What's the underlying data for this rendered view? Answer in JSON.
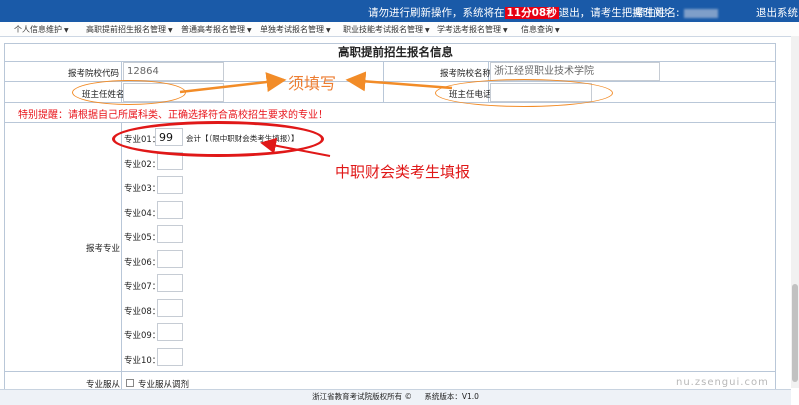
{
  "header": {
    "notice_prefix": "请勿进行刷新操作，系统将在",
    "countdown": "11分08秒",
    "notice_suffix": "退出，请考生把握时间!",
    "examinee_label": "考生姓名:",
    "logout": "退出系统",
    "bg_color": "#1a5aa8",
    "countdown_color": "#e60012"
  },
  "menu": [
    {
      "label": "个人信息维护"
    },
    {
      "label": "高职提前招生报名管理"
    },
    {
      "label": "普通高考报名管理"
    },
    {
      "label": "单独考试报名管理"
    },
    {
      "label": "职业技能考试报名管理"
    },
    {
      "label": "学考选考报名管理"
    },
    {
      "label": "信息查询"
    }
  ],
  "form": {
    "title": "高职提前招生报名信息",
    "school_code_label": "报考院校代码",
    "school_code_value": "12864",
    "school_name_label": "报考院校名称",
    "school_name_value": "浙江经贸职业技术学院",
    "teacher_name_label": "班主任姓名",
    "teacher_phone_label": "班主任电话",
    "warning": "特别提醒：请根据自己所属科类、正确选择符合高校招生要求的专业！",
    "major_section_label": "报考专业",
    "majors": [
      {
        "label": "专业01：",
        "value": "99",
        "desc": "会计【（限中职财会类考生填报）】"
      },
      {
        "label": "专业02：",
        "value": ""
      },
      {
        "label": "专业03：",
        "value": ""
      },
      {
        "label": "专业04：",
        "value": ""
      },
      {
        "label": "专业05：",
        "value": ""
      },
      {
        "label": "专业06：",
        "value": ""
      },
      {
        "label": "专业07：",
        "value": ""
      },
      {
        "label": "专业08：",
        "value": ""
      },
      {
        "label": "专业09：",
        "value": ""
      },
      {
        "label": "专业10：",
        "value": ""
      }
    ],
    "adjust_label": "专业服从",
    "adjust_checkbox_label": "专业服从调剂"
  },
  "annotations": {
    "must_fill": "须填写",
    "vocational_finance": "中职财会类考生填报",
    "orange": "#f28c28",
    "red": "#e01818"
  },
  "footer": {
    "copyright": "浙江省教育考试院版权所有 ©",
    "version": "系统版本：V1.0"
  },
  "watermark": "nu.zsengui.com"
}
